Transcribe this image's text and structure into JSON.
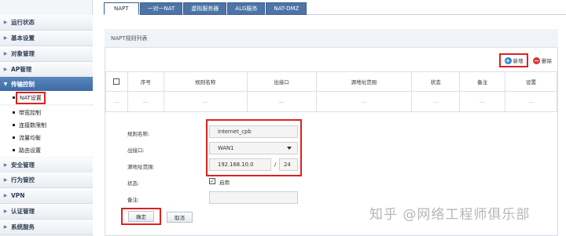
{
  "sidebar": {
    "items": [
      {
        "label": "运行状态",
        "arrow": "▶"
      },
      {
        "label": "基本设置",
        "arrow": "▶"
      },
      {
        "label": "对象管理",
        "arrow": "▶"
      },
      {
        "label": "AP管理",
        "arrow": "▶"
      },
      {
        "label": "传输控制",
        "arrow": "▼"
      },
      {
        "label": "安全管理",
        "arrow": "▶"
      },
      {
        "label": "行为管控",
        "arrow": "▶"
      },
      {
        "label": "VPN",
        "arrow": "▶"
      },
      {
        "label": "认证管理",
        "arrow": "▶"
      },
      {
        "label": "系统服务",
        "arrow": "▶"
      }
    ],
    "subitems": [
      {
        "label": "NAT设置"
      },
      {
        "label": "带宽控制"
      },
      {
        "label": "连接数限制"
      },
      {
        "label": "流量均衡"
      },
      {
        "label": "路由设置"
      }
    ]
  },
  "tabs": [
    {
      "label": "NAPT"
    },
    {
      "label": "一对一NAT"
    },
    {
      "label": "虚拟服务器"
    },
    {
      "label": "ALG服务"
    },
    {
      "label": "NAT-DMZ"
    }
  ],
  "panel": {
    "title": "NAPT规则列表"
  },
  "actions": {
    "add_icon": "+",
    "add_label": "新增",
    "delete_icon": "−",
    "delete_label": "删除"
  },
  "table": {
    "headers": [
      "序号",
      "规则名称",
      "出接口",
      "源地址范围",
      "状态",
      "备注",
      "设置"
    ],
    "empty_row": [
      "---",
      "---",
      "---",
      "---",
      "---",
      "---",
      "---",
      "---"
    ]
  },
  "form": {
    "rule_name_label": "规则名称:",
    "rule_name_value": "internet_cpb",
    "interface_label": "出接口:",
    "interface_value": "WAN1",
    "source_label": "源地址范围:",
    "source_ip": "192.168.10.0",
    "slash": "/",
    "source_mask": "24",
    "status_label": "状态:",
    "status_text": "启用",
    "status_check": "✓",
    "remark_label": "备注:",
    "remark_value": ""
  },
  "buttons": {
    "confirm": "确定",
    "cancel": "取消"
  },
  "watermark": "知乎 @网络工程师俱乐部",
  "colors": {
    "accent": "#3d6aa5",
    "highlight": "#e02020",
    "add": "#2a8ad4",
    "delete": "#e03333"
  }
}
